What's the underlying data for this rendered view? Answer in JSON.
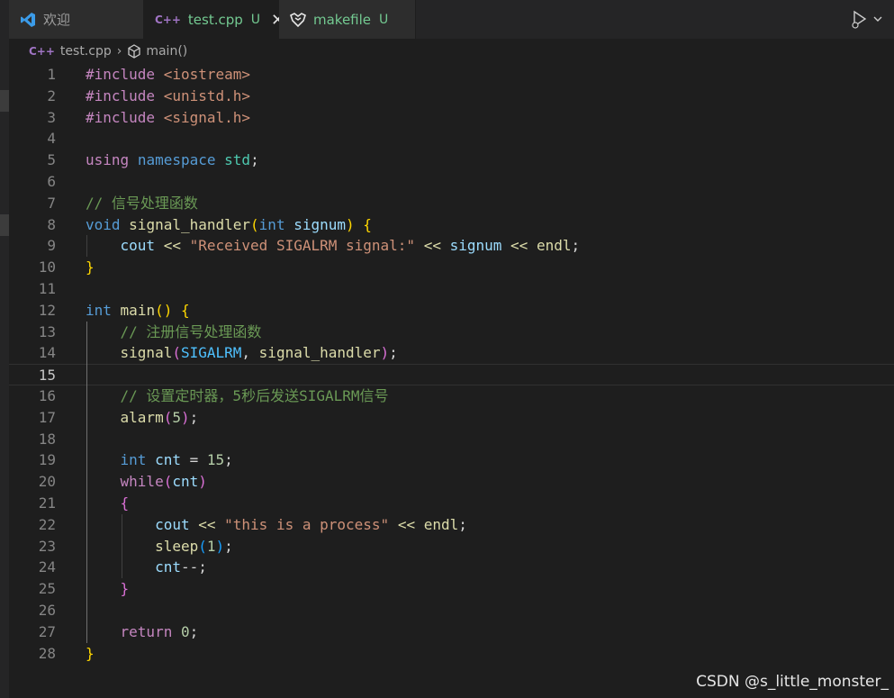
{
  "tabs": [
    {
      "label": "欢迎",
      "icon": "vscode-logo-icon",
      "active": false
    },
    {
      "label": "test.cpp",
      "icon": "cpp-file-icon",
      "status": "U",
      "active": true
    },
    {
      "label": "makefile",
      "icon": "makefile-icon",
      "status": "U",
      "active": false
    }
  ],
  "breadcrumb": {
    "file": "test.cpp",
    "symbol": "main()"
  },
  "editor": {
    "current_line": 15,
    "lines": [
      {
        "n": "1",
        "tokens": [
          {
            "t": "#include ",
            "c": "dir"
          },
          {
            "t": "<iostream>",
            "c": "inc"
          }
        ]
      },
      {
        "n": "2",
        "tokens": [
          {
            "t": "#include ",
            "c": "dir"
          },
          {
            "t": "<unistd.h>",
            "c": "inc"
          }
        ]
      },
      {
        "n": "3",
        "tokens": [
          {
            "t": "#include ",
            "c": "dir"
          },
          {
            "t": "<signal.h>",
            "c": "inc"
          }
        ]
      },
      {
        "n": "4",
        "tokens": []
      },
      {
        "n": "5",
        "tokens": [
          {
            "t": "using",
            "c": "ctl"
          },
          {
            "t": " ",
            "c": "plain"
          },
          {
            "t": "namespace",
            "c": "kw"
          },
          {
            "t": " ",
            "c": "plain"
          },
          {
            "t": "std",
            "c": "type"
          },
          {
            "t": ";",
            "c": "plain"
          }
        ]
      },
      {
        "n": "6",
        "tokens": []
      },
      {
        "n": "7",
        "tokens": [
          {
            "t": "// 信号处理函数",
            "c": "com"
          }
        ]
      },
      {
        "n": "8",
        "tokens": [
          {
            "t": "void",
            "c": "kw"
          },
          {
            "t": " ",
            "c": "plain"
          },
          {
            "t": "signal_handler",
            "c": "fn"
          },
          {
            "t": "(",
            "c": "b1"
          },
          {
            "t": "int",
            "c": "kw"
          },
          {
            "t": " ",
            "c": "plain"
          },
          {
            "t": "signum",
            "c": "var"
          },
          {
            "t": ")",
            "c": "b1"
          },
          {
            "t": " ",
            "c": "plain"
          },
          {
            "t": "{",
            "c": "b1"
          }
        ]
      },
      {
        "n": "9",
        "tokens": [
          {
            "t": "    ",
            "c": "plain"
          },
          {
            "t": "cout",
            "c": "var"
          },
          {
            "t": " ",
            "c": "plain"
          },
          {
            "t": "<<",
            "c": "fn"
          },
          {
            "t": " ",
            "c": "plain"
          },
          {
            "t": "\"Received SIGALRM signal:\"",
            "c": "str"
          },
          {
            "t": " ",
            "c": "plain"
          },
          {
            "t": "<<",
            "c": "fn"
          },
          {
            "t": " ",
            "c": "plain"
          },
          {
            "t": "signum",
            "c": "var"
          },
          {
            "t": " ",
            "c": "plain"
          },
          {
            "t": "<<",
            "c": "fn"
          },
          {
            "t": " ",
            "c": "plain"
          },
          {
            "t": "endl",
            "c": "fn"
          },
          {
            "t": ";",
            "c": "plain"
          }
        ]
      },
      {
        "n": "10",
        "tokens": [
          {
            "t": "}",
            "c": "b1"
          }
        ]
      },
      {
        "n": "11",
        "tokens": []
      },
      {
        "n": "12",
        "tokens": [
          {
            "t": "int",
            "c": "kw"
          },
          {
            "t": " ",
            "c": "plain"
          },
          {
            "t": "main",
            "c": "fn"
          },
          {
            "t": "()",
            "c": "b1"
          },
          {
            "t": " ",
            "c": "plain"
          },
          {
            "t": "{",
            "c": "b1"
          }
        ]
      },
      {
        "n": "13",
        "tokens": [
          {
            "t": "    ",
            "c": "plain"
          },
          {
            "t": "// 注册信号处理函数",
            "c": "com"
          }
        ]
      },
      {
        "n": "14",
        "tokens": [
          {
            "t": "    ",
            "c": "plain"
          },
          {
            "t": "signal",
            "c": "fn"
          },
          {
            "t": "(",
            "c": "b2"
          },
          {
            "t": "SIGALRM",
            "c": "mac"
          },
          {
            "t": ", ",
            "c": "plain"
          },
          {
            "t": "signal_handler",
            "c": "fn"
          },
          {
            "t": ")",
            "c": "b2"
          },
          {
            "t": ";",
            "c": "plain"
          }
        ]
      },
      {
        "n": "15",
        "tokens": []
      },
      {
        "n": "16",
        "tokens": [
          {
            "t": "    ",
            "c": "plain"
          },
          {
            "t": "// 设置定时器，5秒后发送SIGALRM信号",
            "c": "com"
          }
        ]
      },
      {
        "n": "17",
        "tokens": [
          {
            "t": "    ",
            "c": "plain"
          },
          {
            "t": "alarm",
            "c": "fn"
          },
          {
            "t": "(",
            "c": "b2"
          },
          {
            "t": "5",
            "c": "num"
          },
          {
            "t": ")",
            "c": "b2"
          },
          {
            "t": ";",
            "c": "plain"
          }
        ]
      },
      {
        "n": "18",
        "tokens": []
      },
      {
        "n": "19",
        "tokens": [
          {
            "t": "    ",
            "c": "plain"
          },
          {
            "t": "int",
            "c": "kw"
          },
          {
            "t": " ",
            "c": "plain"
          },
          {
            "t": "cnt",
            "c": "var"
          },
          {
            "t": " = ",
            "c": "plain"
          },
          {
            "t": "15",
            "c": "num"
          },
          {
            "t": ";",
            "c": "plain"
          }
        ]
      },
      {
        "n": "20",
        "tokens": [
          {
            "t": "    ",
            "c": "plain"
          },
          {
            "t": "while",
            "c": "ctl"
          },
          {
            "t": "(",
            "c": "b2"
          },
          {
            "t": "cnt",
            "c": "var"
          },
          {
            "t": ")",
            "c": "b2"
          }
        ]
      },
      {
        "n": "21",
        "tokens": [
          {
            "t": "    ",
            "c": "plain"
          },
          {
            "t": "{",
            "c": "b2"
          }
        ]
      },
      {
        "n": "22",
        "tokens": [
          {
            "t": "        ",
            "c": "plain"
          },
          {
            "t": "cout",
            "c": "var"
          },
          {
            "t": " ",
            "c": "plain"
          },
          {
            "t": "<<",
            "c": "fn"
          },
          {
            "t": " ",
            "c": "plain"
          },
          {
            "t": "\"this is a process\"",
            "c": "str"
          },
          {
            "t": " ",
            "c": "plain"
          },
          {
            "t": "<<",
            "c": "fn"
          },
          {
            "t": " ",
            "c": "plain"
          },
          {
            "t": "endl",
            "c": "fn"
          },
          {
            "t": ";",
            "c": "plain"
          }
        ]
      },
      {
        "n": "23",
        "tokens": [
          {
            "t": "        ",
            "c": "plain"
          },
          {
            "t": "sleep",
            "c": "fn"
          },
          {
            "t": "(",
            "c": "b3"
          },
          {
            "t": "1",
            "c": "num"
          },
          {
            "t": ")",
            "c": "b3"
          },
          {
            "t": ";",
            "c": "plain"
          }
        ]
      },
      {
        "n": "24",
        "tokens": [
          {
            "t": "        ",
            "c": "plain"
          },
          {
            "t": "cnt",
            "c": "var"
          },
          {
            "t": "--;",
            "c": "plain"
          }
        ]
      },
      {
        "n": "25",
        "tokens": [
          {
            "t": "    ",
            "c": "plain"
          },
          {
            "t": "}",
            "c": "b2"
          }
        ]
      },
      {
        "n": "26",
        "tokens": []
      },
      {
        "n": "27",
        "tokens": [
          {
            "t": "    ",
            "c": "plain"
          },
          {
            "t": "return",
            "c": "ctl"
          },
          {
            "t": " ",
            "c": "plain"
          },
          {
            "t": "0",
            "c": "num"
          },
          {
            "t": ";",
            "c": "plain"
          }
        ]
      },
      {
        "n": "28",
        "tokens": [
          {
            "t": "}",
            "c": "b1"
          }
        ]
      }
    ]
  },
  "watermark": "CSDN @s_little_monster_",
  "colors": {
    "background": "#1e1e1e",
    "modified": "#73c991",
    "keyword": "#569cd6",
    "string": "#ce9178",
    "comment": "#6a9955"
  }
}
